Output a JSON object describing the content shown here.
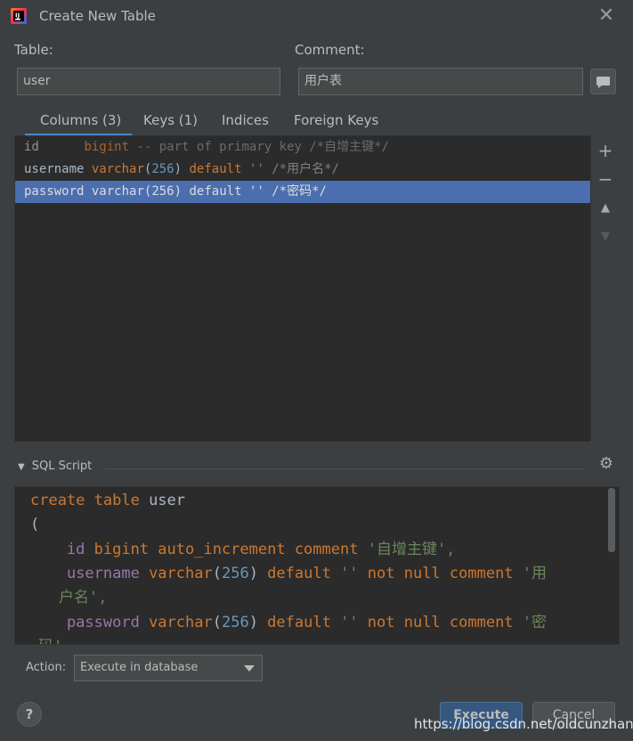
{
  "window": {
    "title": "Create New Table",
    "close_icon": "close-icon"
  },
  "table_field": {
    "label": "Table:",
    "value": "user"
  },
  "comment_field": {
    "label": "Comment:",
    "value": "用户表"
  },
  "tabs": [
    {
      "label": "Columns (3)",
      "selected": true
    },
    {
      "label": "Keys (1)",
      "selected": false
    },
    {
      "label": "Indices",
      "selected": false
    },
    {
      "label": "Foreign Keys",
      "selected": false
    }
  ],
  "columns": [
    {
      "name": "id",
      "def1": "bigint",
      "def2": " -- part of primary key ",
      "comment": "/*自增主键*/"
    },
    {
      "name": "username",
      "type": "varchar",
      "lp": "(",
      "size": "256",
      "rp": ")",
      "kw": " default",
      "str": " ''",
      "comment": " /*用户名*/"
    },
    {
      "name": "password",
      "type": "varchar",
      "lp": "(",
      "size": "256",
      "rp": ")",
      "kw": " default",
      "str": " ''",
      "comment": " /*密码*/",
      "selected": true
    }
  ],
  "tools": {
    "add": "+",
    "remove": "−",
    "up": "▲",
    "down": "▼"
  },
  "sql": {
    "header": "SQL Script",
    "lines": {
      "l1_kw": "create table",
      "l1_name": " user",
      "l2": "(",
      "l3_name": "    id",
      "l3_kw": " bigint auto_increment comment",
      "l3_str": " '自增主键',",
      "l4_name": "    username",
      "l4_kw": " varchar",
      "l4_lp": "(",
      "l4_num": "256",
      "l4_rp": ")",
      "l4_kw2": " default",
      "l4_str": " ''",
      "l4_kw3": " not null comment",
      "l4_str2": " '用",
      "l5_str": "户名',",
      "l6_name": "    password",
      "l6_kw": " varchar",
      "l6_lp": "(",
      "l6_num": "256",
      "l6_rp": ")",
      "l6_kw2": " default",
      "l6_str": " ''",
      "l6_kw3": " not null comment",
      "l6_str2": " '密",
      "l7_str": "码'"
    }
  },
  "action": {
    "label": "Action:",
    "value": "Execute in database"
  },
  "buttons": {
    "help": "?",
    "execute": "Execute",
    "cancel": "Cancel"
  },
  "watermark": "https://blog.csdn.net/oldcunzhang",
  "colors": {
    "accent": "#4a88c7",
    "keyword": "#cc7832",
    "number": "#6897bb",
    "string": "#6a8759",
    "selection": "#4b6eaf"
  }
}
